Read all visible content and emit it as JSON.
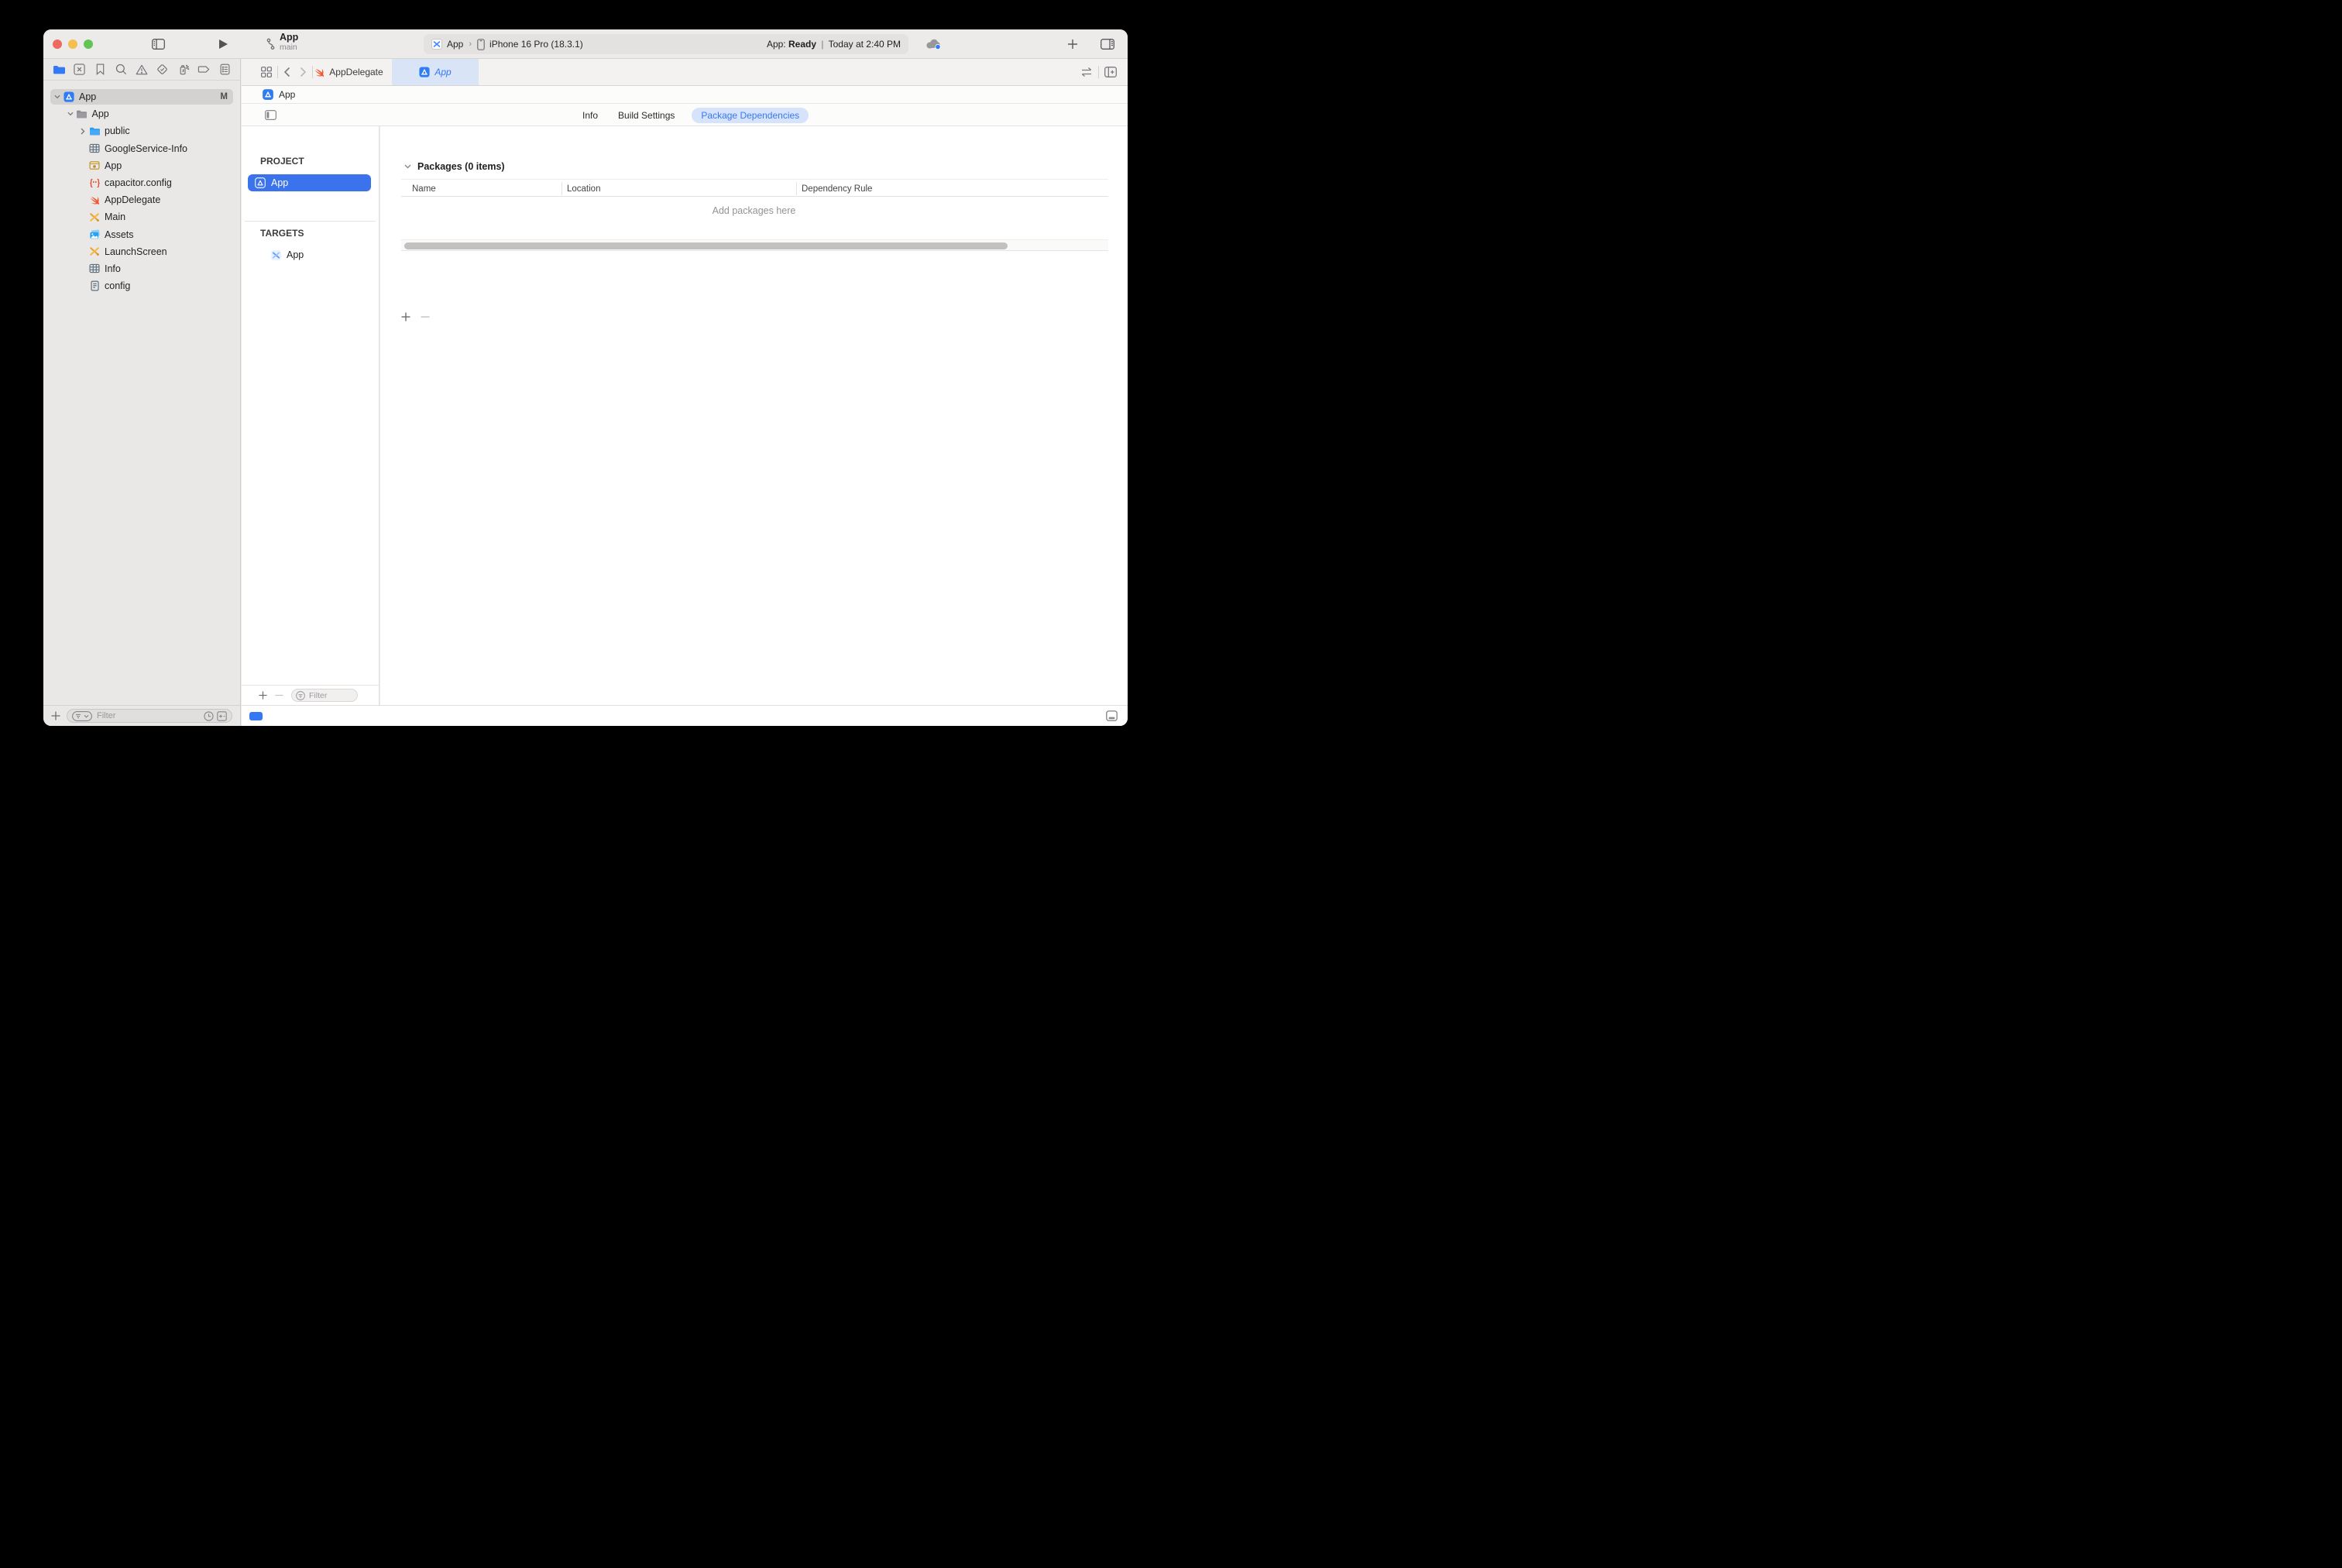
{
  "toolbar": {
    "project_name": "App",
    "branch_name": "main",
    "scheme": {
      "target": "App",
      "chevron": "›",
      "device": "iPhone 16 Pro (18.3.1)"
    },
    "status": {
      "prefix": "App:",
      "state": "Ready",
      "separator": "|",
      "time": "Today at 2:40 PM"
    }
  },
  "tab_bar": {
    "tabs": [
      {
        "label": "AppDelegate",
        "icon": "swift",
        "active": false
      },
      {
        "label": "App",
        "icon": "app-project",
        "active": true
      }
    ]
  },
  "jump_bar": {
    "item": "App"
  },
  "config_bar": {
    "tabs": [
      {
        "label": "Info",
        "active": false
      },
      {
        "label": "Build Settings",
        "active": false
      },
      {
        "label": "Package Dependencies",
        "active": true
      }
    ]
  },
  "navigator": {
    "icons": [
      {
        "name": "folder",
        "selected": true
      },
      {
        "name": "xsquare",
        "selected": false
      },
      {
        "name": "bookmark",
        "selected": false
      },
      {
        "name": "search",
        "selected": false
      },
      {
        "name": "warning",
        "selected": false
      },
      {
        "name": "diamond-check",
        "selected": false
      },
      {
        "name": "spray",
        "selected": false
      },
      {
        "name": "tag",
        "selected": false
      },
      {
        "name": "report",
        "selected": false
      }
    ],
    "tree": [
      {
        "label": "App",
        "icon": "app-project",
        "indent": 0,
        "chevron": "down",
        "selected": true,
        "badge": "M"
      },
      {
        "label": "App",
        "icon": "folder-gray",
        "indent": 1,
        "chevron": "down"
      },
      {
        "label": "public",
        "icon": "folder-blue",
        "indent": 2,
        "chevron": "right"
      },
      {
        "label": "GoogleService-Info",
        "icon": "plist",
        "indent": 2
      },
      {
        "label": "App",
        "icon": "entitlements",
        "indent": 2
      },
      {
        "label": "capacitor.config",
        "icon": "braces",
        "indent": 2
      },
      {
        "label": "AppDelegate",
        "icon": "swift",
        "indent": 2
      },
      {
        "label": "Main",
        "icon": "storyboard",
        "indent": 2
      },
      {
        "label": "Assets",
        "icon": "assets",
        "indent": 2
      },
      {
        "label": "LaunchScreen",
        "icon": "storyboard",
        "indent": 2
      },
      {
        "label": "Info",
        "icon": "plist",
        "indent": 2
      },
      {
        "label": "config",
        "icon": "doc",
        "indent": 2
      }
    ],
    "filter_placeholder": "Filter"
  },
  "project_editor": {
    "project_section": "PROJECT",
    "projects": [
      {
        "label": "App",
        "selected": true
      }
    ],
    "targets_section": "TARGETS",
    "targets": [
      {
        "label": "App"
      }
    ],
    "filter_placeholder": "Filter",
    "packages": {
      "title": "Packages (0 items)",
      "columns": [
        "Name",
        "Location",
        "Dependency Rule"
      ],
      "empty_message": "Add packages here"
    }
  },
  "colors": {
    "accent_blue": "#3478f6",
    "selection_blue": "#3b73ec",
    "active_tab_bg": "#d9e4f6",
    "package_pill_bg": "#d7e3fa",
    "traffic_red": "#ec6a5e",
    "traffic_yellow": "#f4bf4f",
    "traffic_green": "#61c554"
  }
}
